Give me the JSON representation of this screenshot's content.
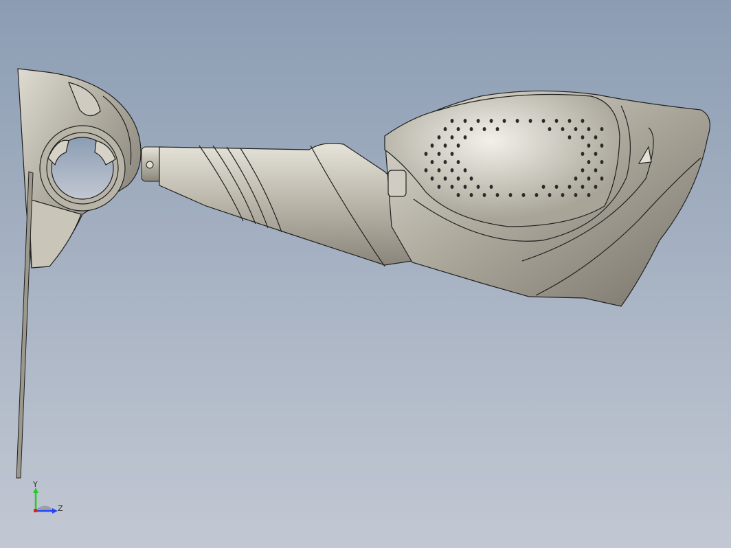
{
  "viewport": {
    "background_top": "#8c9db3",
    "background_bottom": "#c2c8d3",
    "model_color": "#c8c4b8",
    "model_dark": "#7e7a70",
    "edge_color": "#202020"
  },
  "triad": {
    "y_label": "Y",
    "z_label": "Z",
    "y_color": "#22cc22",
    "z_color": "#2244ff",
    "x_color": "#dd2222"
  }
}
